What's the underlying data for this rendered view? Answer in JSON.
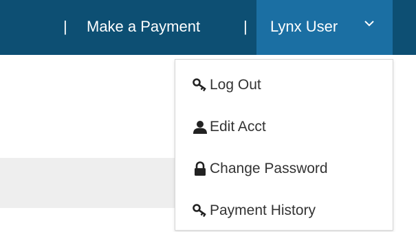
{
  "topbar": {
    "separator": "|",
    "make_payment_label": "Make a Payment",
    "user_menu_label": "Lynx User",
    "background_color": "#0d4f73",
    "active_color": "#1b6fa3"
  },
  "dropdown": {
    "items": [
      {
        "label": "Log Out",
        "icon": "key-icon"
      },
      {
        "label": "Edit Acct",
        "icon": "user-icon"
      },
      {
        "label": "Change Password",
        "icon": "lock-icon"
      },
      {
        "label": "Payment History",
        "icon": "key-icon"
      }
    ]
  }
}
